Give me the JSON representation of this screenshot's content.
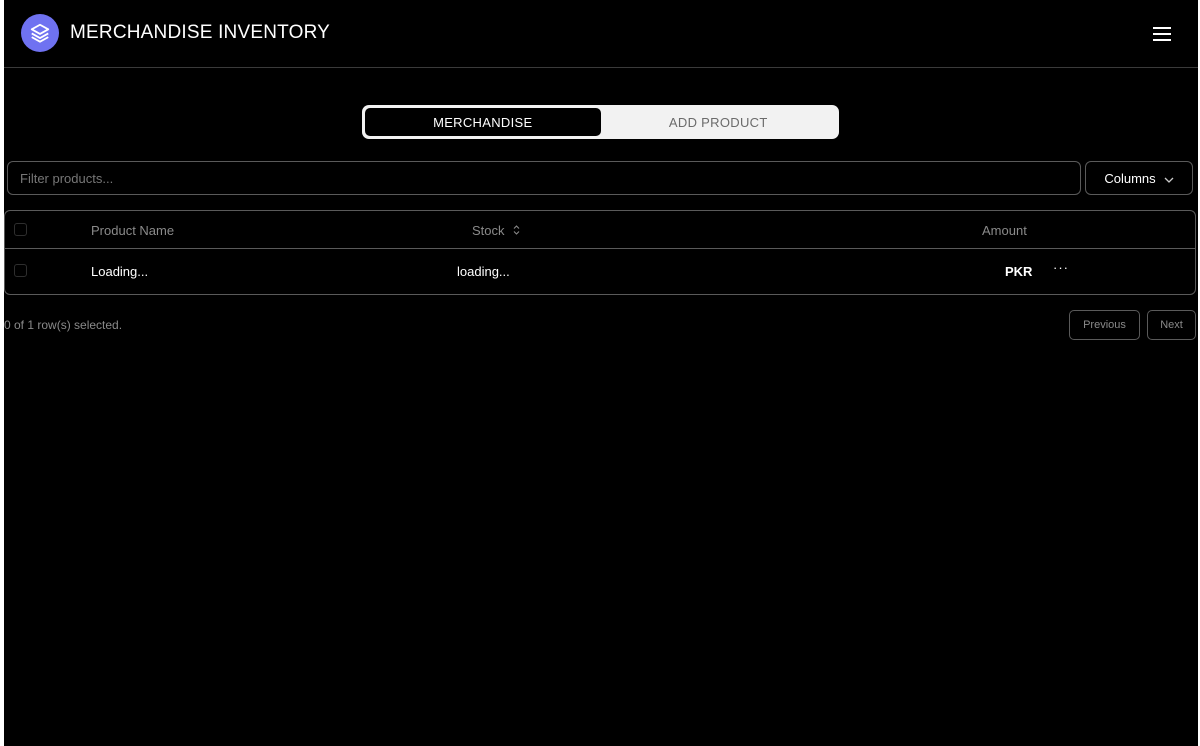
{
  "header": {
    "title": "MERCHANDISE INVENTORY",
    "logo_icon": "layers-icon",
    "menu_icon": "hamburger-menu-icon",
    "logo_color": "#6f72f1"
  },
  "tabs": [
    {
      "label": "MERCHANDISE",
      "active": true
    },
    {
      "label": "ADD PRODUCT",
      "active": false
    }
  ],
  "filter": {
    "placeholder": "Filter products...",
    "value": ""
  },
  "columns_button": {
    "label": "Columns",
    "icon": "chevron-down-icon"
  },
  "table": {
    "headers": {
      "product_name": "Product Name",
      "stock": "Stock",
      "amount": "Amount"
    },
    "rows": [
      {
        "product_name": "Loading...",
        "stock": "loading...",
        "amount": "PKR",
        "actions": "···"
      }
    ]
  },
  "footer": {
    "selection_status": "0 of 1 row(s) selected.",
    "previous_label": "Previous",
    "next_label": "Next"
  }
}
